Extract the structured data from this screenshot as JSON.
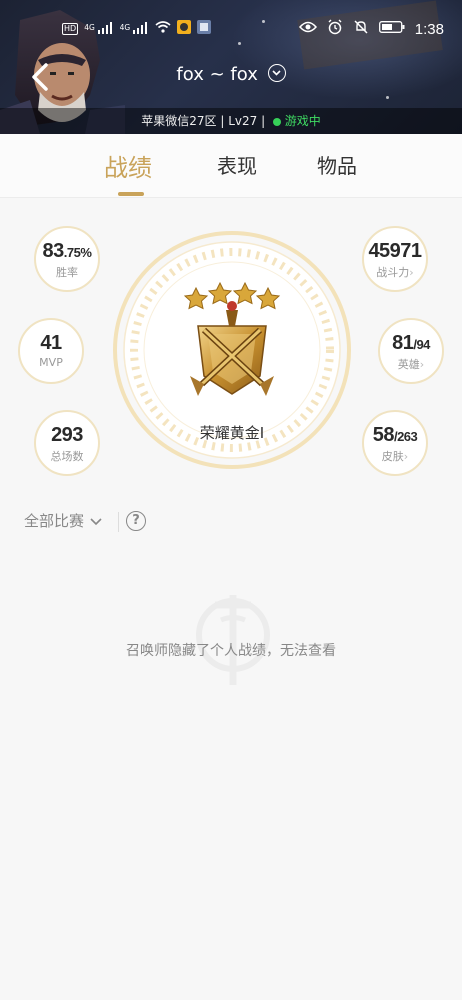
{
  "status_bar": {
    "hd_label": "HD",
    "net_label_1": "4G",
    "net_label_2": "4G",
    "time": "1:38"
  },
  "header": {
    "title": "fox ~ fox",
    "server": "苹果微信27区",
    "level": "Lv27",
    "status": "游戏中"
  },
  "tabs": [
    {
      "label": "战绩",
      "active": true
    },
    {
      "label": "表现",
      "active": false
    },
    {
      "label": "物品",
      "active": false
    }
  ],
  "stats": {
    "win_rate": {
      "value": "83",
      "decimal": ".75%",
      "label": "胜率"
    },
    "mvp": {
      "value": "41",
      "label": "MVP"
    },
    "total_games": {
      "value": "293",
      "label": "总场数"
    },
    "power": {
      "value": "45971",
      "label": "战斗力"
    },
    "heroes": {
      "value": "81",
      "total": "/94",
      "label": "英雄"
    },
    "skins": {
      "value": "58",
      "total": "/263",
      "label": "皮肤"
    }
  },
  "rank": {
    "name": "荣耀黄金I",
    "stars": 4
  },
  "filter": {
    "label": "全部比赛"
  },
  "empty_message": "召唤师隐藏了个人战绩，无法查看",
  "colors": {
    "accent_gold": "#c9a35a",
    "online_green": "#36d058"
  }
}
